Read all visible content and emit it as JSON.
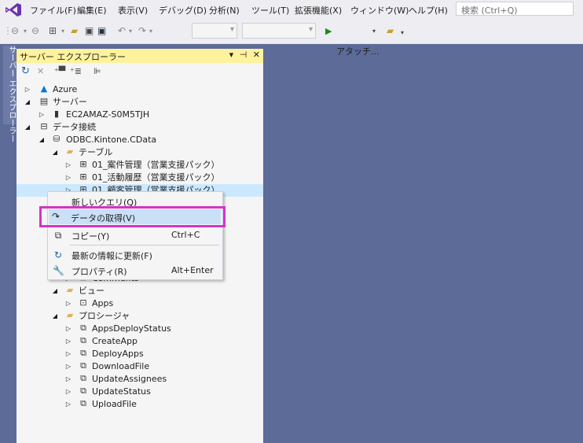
{
  "menubar": {
    "items": [
      "ファイル(F)",
      "編集(E)",
      "表示(V)",
      "デバッグ(D)",
      "分析(N)",
      "ツール(T)",
      "拡張機能(X)",
      "ウィンドウ(W)",
      "ヘルプ(H)"
    ],
    "search_placeholder": "検索 (Ctrl+Q)"
  },
  "toolbar": {
    "attach_label": "アタッチ..."
  },
  "sidestrip": {
    "label": "サーバー エクスプローラー"
  },
  "panel": {
    "title": "サーバー エクスプローラー",
    "tree": [
      {
        "label": "Azure"
      },
      {
        "label": "サーバー"
      },
      {
        "label": "EC2AMAZ-S0M5TJH"
      },
      {
        "label": "データ接続"
      },
      {
        "label": "ODBC.Kintone.CData"
      },
      {
        "label": "テーブル"
      },
      {
        "label": "01_案件管理（営業支援パック）"
      },
      {
        "label": "01_活動履歴（営業支援パック）"
      },
      {
        "label": "01_顧客管理（営業支援パック）"
      },
      {
        "label": "Comments"
      },
      {
        "label": "ビュー"
      },
      {
        "label": "Apps"
      },
      {
        "label": "プロシージャ"
      },
      {
        "label": "AppsDeployStatus"
      },
      {
        "label": "CreateApp"
      },
      {
        "label": "DeployApps"
      },
      {
        "label": "DownloadFile"
      },
      {
        "label": "UpdateAssignees"
      },
      {
        "label": "UpdateStatus"
      },
      {
        "label": "UploadFile"
      }
    ]
  },
  "context_menu": {
    "new_query": "新しいクエリ(Q)",
    "retrieve_data": "データの取得(V)",
    "copy": "コピー(Y)",
    "copy_shortcut": "Ctrl+C",
    "refresh": "最新の情報に更新(F)",
    "properties": "プロパティ(R)",
    "properties_shortcut": "Alt+Enter"
  },
  "colors": {
    "highlight_border": "#d633c3",
    "panel_title_bg": "#fff29d",
    "selection_bg": "#cce8ff"
  }
}
